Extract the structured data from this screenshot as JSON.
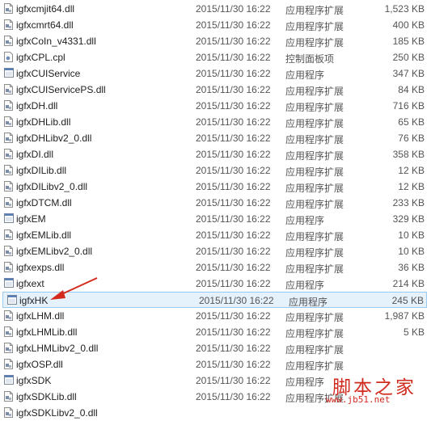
{
  "files": [
    {
      "name": "igfxcmjit64.dll",
      "date": "2015/11/30 16:22",
      "type": "应用程序扩展",
      "size": "1,523 KB",
      "icon": "dll-icon"
    },
    {
      "name": "igfxcmrt64.dll",
      "date": "2015/11/30 16:22",
      "type": "应用程序扩展",
      "size": "400 KB",
      "icon": "dll-icon"
    },
    {
      "name": "igfxCoIn_v4331.dll",
      "date": "2015/11/30 16:22",
      "type": "应用程序扩展",
      "size": "185 KB",
      "icon": "dll-icon"
    },
    {
      "name": "igfxCPL.cpl",
      "date": "2015/11/30 16:22",
      "type": "控制面板项",
      "size": "250 KB",
      "icon": "cpl-icon"
    },
    {
      "name": "igfxCUIService",
      "date": "2015/11/30 16:22",
      "type": "应用程序",
      "size": "347 KB",
      "icon": "exe-icon"
    },
    {
      "name": "igfxCUIServicePS.dll",
      "date": "2015/11/30 16:22",
      "type": "应用程序扩展",
      "size": "84 KB",
      "icon": "dll-icon"
    },
    {
      "name": "igfxDH.dll",
      "date": "2015/11/30 16:22",
      "type": "应用程序扩展",
      "size": "716 KB",
      "icon": "dll-icon"
    },
    {
      "name": "igfxDHLib.dll",
      "date": "2015/11/30 16:22",
      "type": "应用程序扩展",
      "size": "65 KB",
      "icon": "dll-icon"
    },
    {
      "name": "igfxDHLibv2_0.dll",
      "date": "2015/11/30 16:22",
      "type": "应用程序扩展",
      "size": "76 KB",
      "icon": "dll-icon"
    },
    {
      "name": "igfxDI.dll",
      "date": "2015/11/30 16:22",
      "type": "应用程序扩展",
      "size": "358 KB",
      "icon": "dll-icon"
    },
    {
      "name": "igfxDILib.dll",
      "date": "2015/11/30 16:22",
      "type": "应用程序扩展",
      "size": "12 KB",
      "icon": "dll-icon"
    },
    {
      "name": "igfxDILibv2_0.dll",
      "date": "2015/11/30 16:22",
      "type": "应用程序扩展",
      "size": "12 KB",
      "icon": "dll-icon"
    },
    {
      "name": "igfxDTCM.dll",
      "date": "2015/11/30 16:22",
      "type": "应用程序扩展",
      "size": "233 KB",
      "icon": "dll-icon"
    },
    {
      "name": "igfxEM",
      "date": "2015/11/30 16:22",
      "type": "应用程序",
      "size": "329 KB",
      "icon": "exe-icon"
    },
    {
      "name": "igfxEMLib.dll",
      "date": "2015/11/30 16:22",
      "type": "应用程序扩展",
      "size": "10 KB",
      "icon": "dll-icon"
    },
    {
      "name": "igfxEMLibv2_0.dll",
      "date": "2015/11/30 16:22",
      "type": "应用程序扩展",
      "size": "10 KB",
      "icon": "dll-icon"
    },
    {
      "name": "igfxexps.dll",
      "date": "2015/11/30 16:22",
      "type": "应用程序扩展",
      "size": "36 KB",
      "icon": "dll-icon"
    },
    {
      "name": "igfxext",
      "date": "2015/11/30 16:22",
      "type": "应用程序",
      "size": "214 KB",
      "icon": "exe-icon"
    },
    {
      "name": "igfxHK",
      "date": "2015/11/30 16:22",
      "type": "应用程序",
      "size": "245 KB",
      "icon": "exe-icon",
      "selected": true
    },
    {
      "name": "igfxLHM.dll",
      "date": "2015/11/30 16:22",
      "type": "应用程序扩展",
      "size": "1,987 KB",
      "icon": "dll-icon"
    },
    {
      "name": "igfxLHMLib.dll",
      "date": "2015/11/30 16:22",
      "type": "应用程序扩展",
      "size": "5 KB",
      "icon": "dll-icon"
    },
    {
      "name": "igfxLHMLibv2_0.dll",
      "date": "2015/11/30 16:22",
      "type": "应用程序扩展",
      "size": "",
      "icon": "dll-icon"
    },
    {
      "name": "igfxOSP.dll",
      "date": "2015/11/30 16:22",
      "type": "应用程序扩展",
      "size": "",
      "icon": "dll-icon"
    },
    {
      "name": "igfxSDK",
      "date": "2015/11/30 16:22",
      "type": "应用程序",
      "size": "",
      "icon": "exe-icon"
    },
    {
      "name": "igfxSDKLib.dll",
      "date": "2015/11/30 16:22",
      "type": "应用程序扩展",
      "size": "",
      "icon": "dll-icon"
    },
    {
      "name": "igfxSDKLibv2_0.dll",
      "date": "",
      "type": "",
      "size": "",
      "icon": "dll-icon"
    }
  ],
  "watermark": {
    "title": "脚本之家",
    "url": "www.jb51.net"
  },
  "colors": {
    "selection_bg": "#e5f1fb",
    "selection_border": "#99c9ef",
    "arrow": "#d42a1e",
    "watermark": "#d12a1f"
  }
}
